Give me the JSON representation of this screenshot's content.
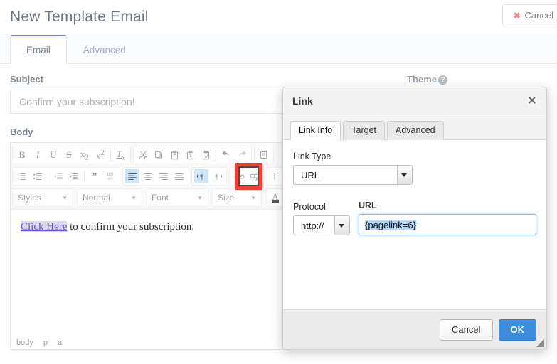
{
  "header": {
    "title": "New Template Email",
    "cancel_label": "Cancel",
    "cancel_icon": "x-icon"
  },
  "tabs": [
    {
      "label": "Email",
      "active": true
    },
    {
      "label": "Advanced",
      "active": false
    }
  ],
  "form": {
    "subject_label": "Subject",
    "subject_placeholder": "Confirm your subscription!",
    "subject_value": "",
    "theme_label": "Theme",
    "theme_help_icon": "question-mark-icon",
    "body_label": "Body"
  },
  "editor": {
    "row1": [
      {
        "group": [
          {
            "name": "bold-button",
            "glyph": "B",
            "style": "bold"
          },
          {
            "name": "italic-button",
            "glyph": "I",
            "style": "italic"
          },
          {
            "name": "underline-button",
            "glyph": "U",
            "style": "underline"
          },
          {
            "name": "strikethrough-button",
            "glyph": "S",
            "style": "strike"
          },
          {
            "name": "subscript-button",
            "glyph": "x₂",
            "style": "plain"
          },
          {
            "name": "superscript-button",
            "glyph": "x²",
            "style": "plain"
          },
          {
            "name": "remove-format-button",
            "glyph": "Tx",
            "style": "plain"
          }
        ]
      },
      {
        "group": [
          {
            "name": "cut-button",
            "glyph": "scissors-icon",
            "style": "icon"
          },
          {
            "name": "copy-button",
            "glyph": "copy-icon",
            "style": "icon"
          },
          {
            "name": "paste-button",
            "glyph": "paste-icon",
            "style": "icon"
          },
          {
            "name": "paste-as-text-button",
            "glyph": "paste-text-icon",
            "style": "icon"
          },
          {
            "name": "paste-from-word-button",
            "glyph": "paste-word-icon",
            "style": "icon"
          },
          {
            "name": "undo-button",
            "glyph": "undo-icon",
            "style": "icon"
          },
          {
            "name": "redo-button",
            "glyph": "redo-icon",
            "style": "icon-dim"
          }
        ]
      }
    ],
    "row2": [
      {
        "group": [
          {
            "name": "numbered-list-button",
            "glyph": "numbered-list-icon"
          },
          {
            "name": "bulleted-list-button",
            "glyph": "bulleted-list-icon"
          },
          {
            "name": "decrease-indent-button",
            "glyph": "outdent-icon"
          },
          {
            "name": "increase-indent-button",
            "glyph": "indent-icon"
          },
          {
            "name": "blockquote-button",
            "glyph": "quote-icon"
          },
          {
            "name": "create-div-button",
            "glyph": "div-icon"
          }
        ]
      },
      {
        "group": [
          {
            "name": "align-left-button",
            "glyph": "align-left-icon",
            "active": true
          },
          {
            "name": "align-center-button",
            "glyph": "align-center-icon"
          },
          {
            "name": "align-right-button",
            "glyph": "align-right-icon"
          },
          {
            "name": "align-justify-button",
            "glyph": "align-justify-icon"
          }
        ]
      },
      {
        "group": [
          {
            "name": "text-direction-ltr-button",
            "glyph": "ltr-icon",
            "active": true
          },
          {
            "name": "text-direction-rtl-button",
            "glyph": "rtl-icon"
          }
        ]
      },
      {
        "group": [
          {
            "name": "link-button",
            "glyph": "link-icon",
            "highlighted": true
          },
          {
            "name": "unlink-button",
            "glyph": "unlink-icon"
          }
        ]
      }
    ],
    "row3": [
      {
        "name": "styles-dropdown",
        "label": "Styles"
      },
      {
        "name": "paragraph-format-dropdown",
        "label": "Normal"
      },
      {
        "name": "font-dropdown",
        "label": "Font"
      },
      {
        "name": "font-size-dropdown",
        "label": "Size"
      },
      {
        "name": "text-color-button",
        "label": "A"
      }
    ],
    "content": {
      "link_text": "Click Here",
      "rest_text": " to confirm your subscription."
    },
    "elements_path": [
      "body",
      "p",
      "a"
    ]
  },
  "dialog": {
    "title": "Link",
    "close_icon": "close-icon",
    "tabs": [
      {
        "label": "Link Info",
        "active": true
      },
      {
        "label": "Target",
        "active": false
      },
      {
        "label": "Advanced",
        "active": false
      }
    ],
    "link_type_label": "Link Type",
    "link_type_value": "URL",
    "protocol_label": "Protocol",
    "protocol_value": "http://",
    "url_label": "URL",
    "url_value": "{pagelink=6}",
    "cancel_label": "Cancel",
    "ok_label": "OK",
    "resize_grip_icon": "resize-grip-icon"
  },
  "colors": {
    "accent_tab": "#7a7ed4",
    "annotation": "#ef4136",
    "primary_button": "#3c8ddc",
    "link_text": "#6a4fd8"
  }
}
